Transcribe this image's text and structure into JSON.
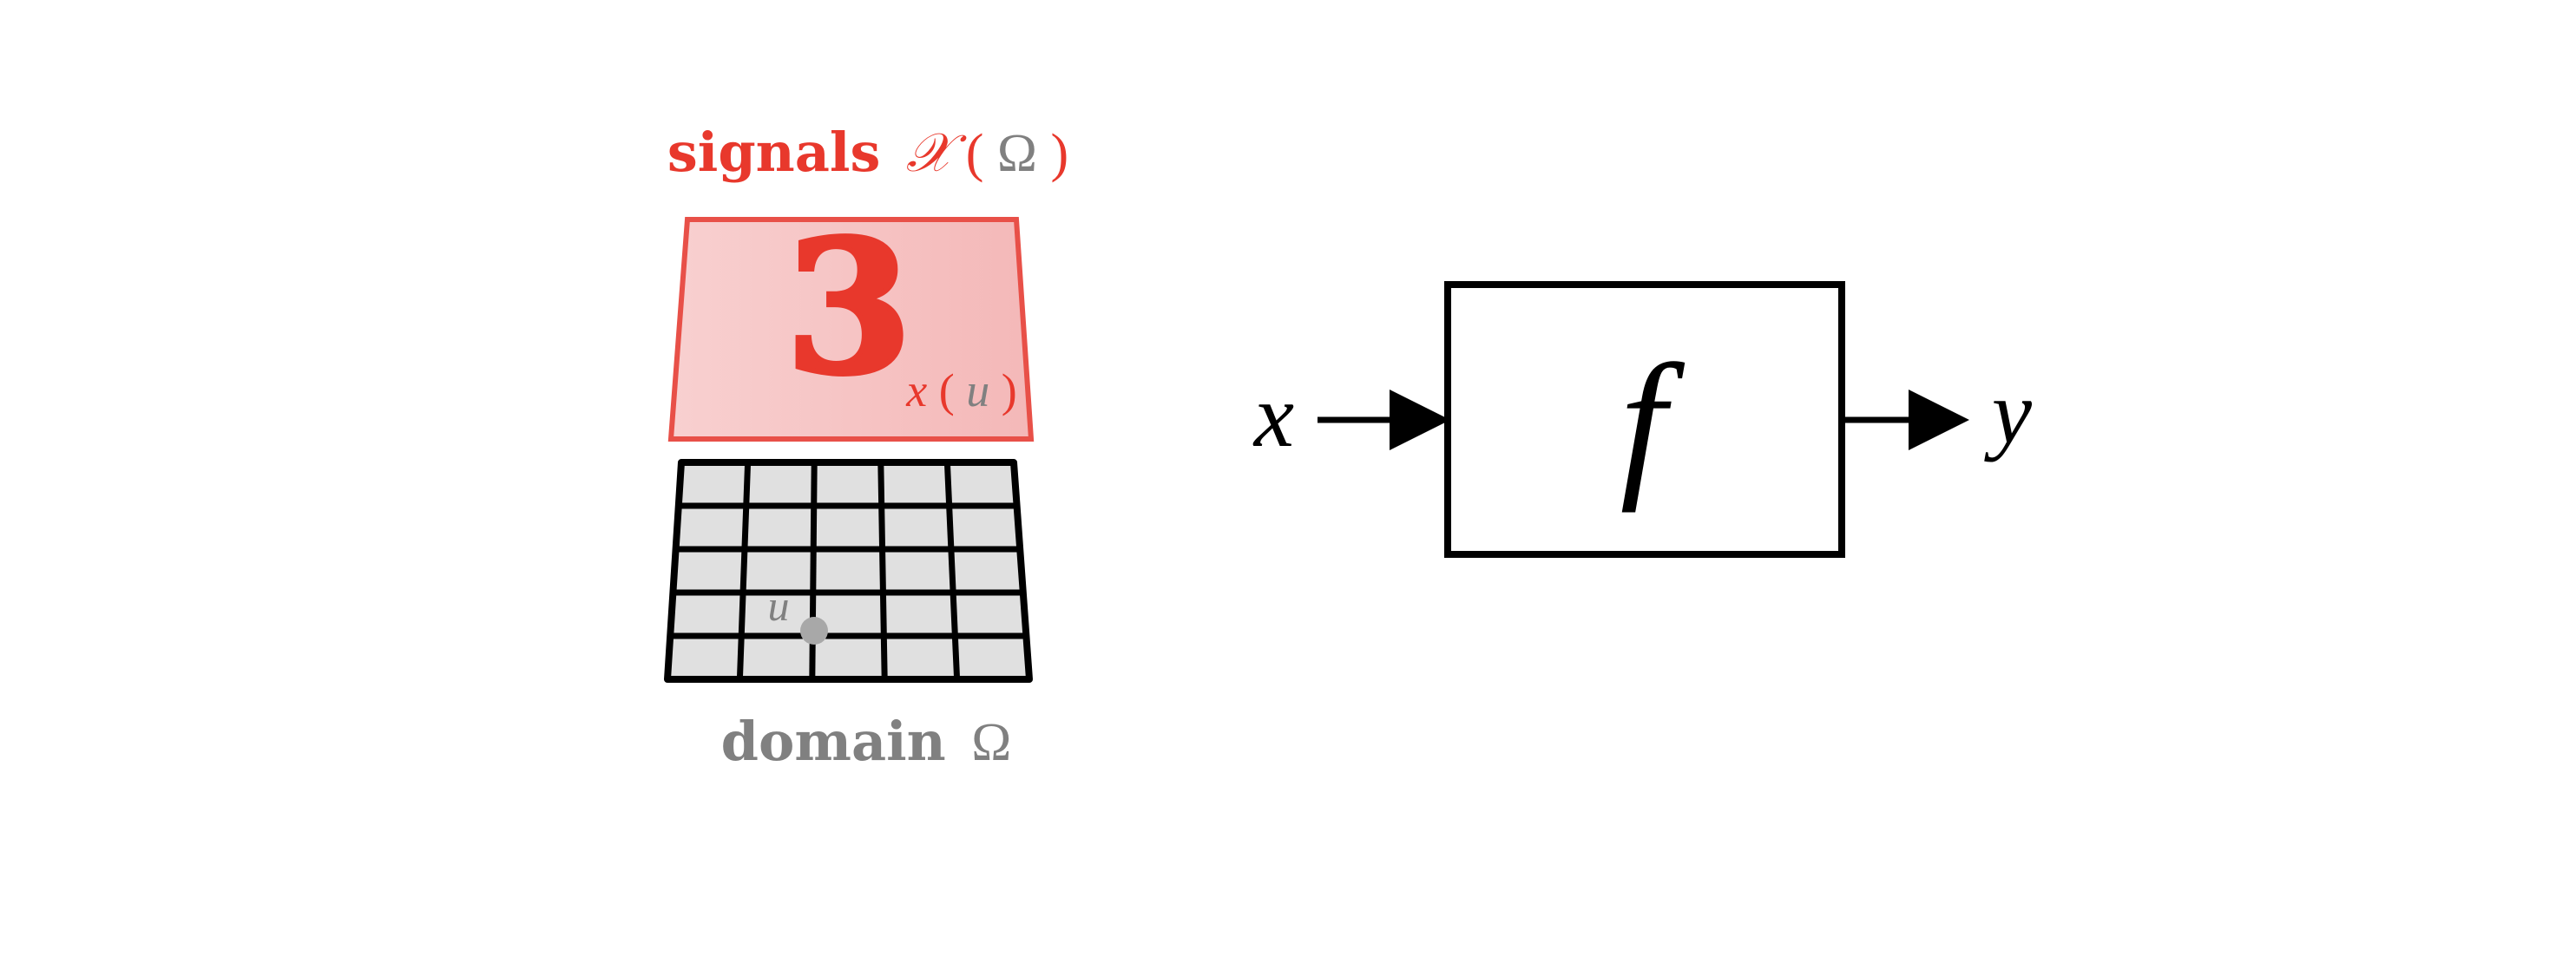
{
  "signals_label": {
    "word": "signals",
    "space_symbol": "𝒳",
    "open_paren": "(",
    "domain_symbol": "Ω",
    "close_paren": ")"
  },
  "digit": "3",
  "signal_value_label": {
    "function": "x",
    "open_paren": "(",
    "argument": "u",
    "close_paren": ")"
  },
  "point_label": "u",
  "domain_label": {
    "word": "domain",
    "symbol": "Ω"
  },
  "input_label": "x",
  "function_label": "f",
  "output_label": "y",
  "colors": {
    "signal": "#e8382c",
    "signal_fill_light": "#f8d0d0",
    "signal_fill_dark": "#f4b8b8",
    "signal_border": "#e85048",
    "domain_text": "#808080",
    "grid_fill": "#e0e0e0",
    "point": "#a8a8a8",
    "ink": "#000000"
  }
}
